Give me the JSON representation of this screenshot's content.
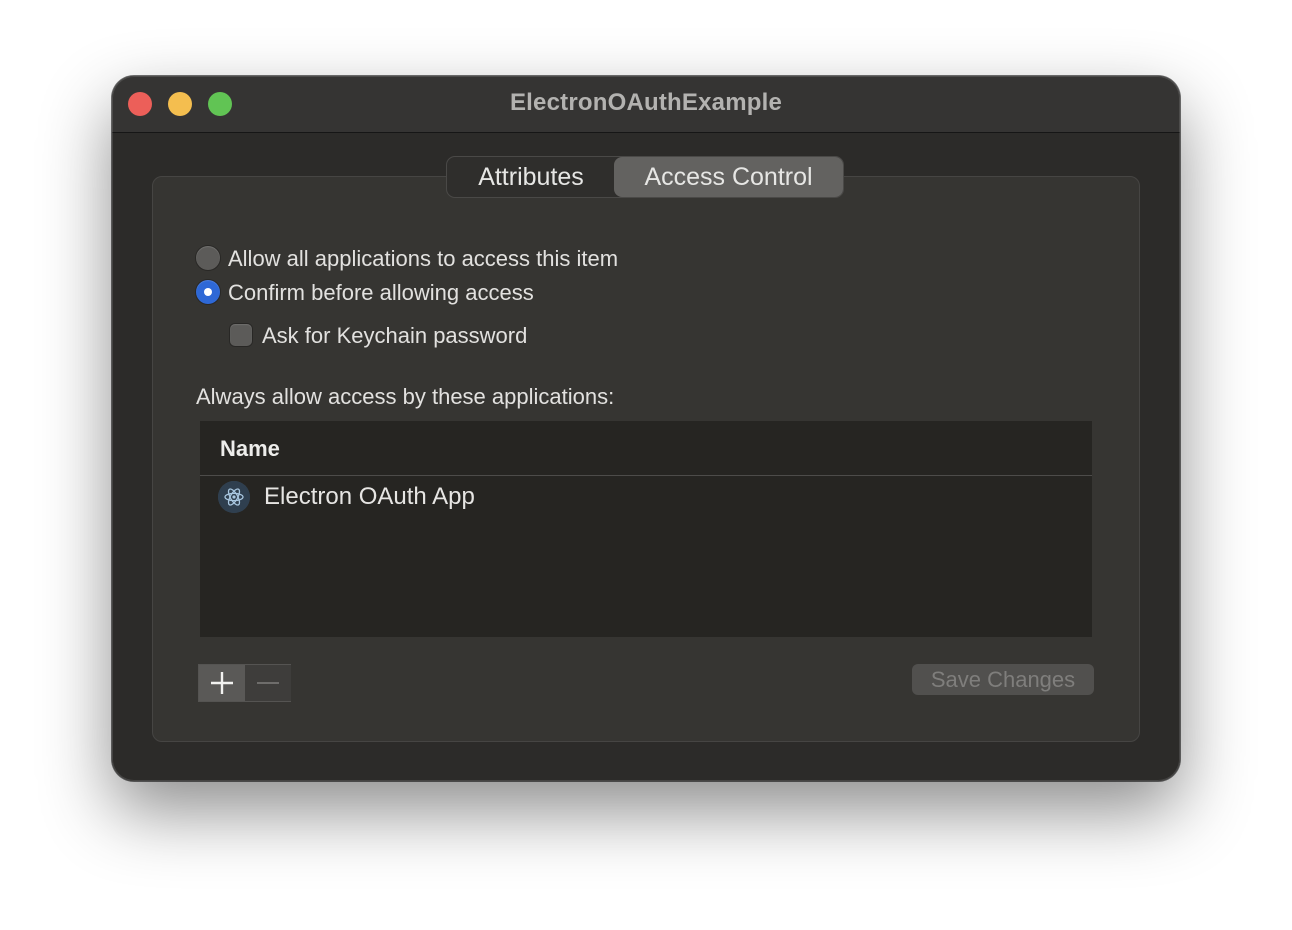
{
  "window": {
    "title": "ElectronOAuthExample"
  },
  "tabs": [
    {
      "label": "Attributes",
      "selected": false
    },
    {
      "label": "Access Control",
      "selected": true
    }
  ],
  "access": {
    "option_allow_all": "Allow all applications to access this item",
    "option_confirm": "Confirm before allowing access",
    "checkbox_keychain": "Ask for Keychain password",
    "selected_option": "confirm",
    "keychain_checked": false
  },
  "apps_section": {
    "label": "Always allow access by these applications:",
    "column_name": "Name",
    "rows": [
      {
        "name": "Electron OAuth App",
        "icon": "electron-app-icon"
      }
    ]
  },
  "buttons": {
    "add_icon": "plus-icon",
    "remove_icon": "minus-icon",
    "save_label": "Save Changes",
    "save_enabled": false
  },
  "colors": {
    "accent": "#2e68d6",
    "close": "#ec5f59",
    "minimize": "#f4be4f",
    "zoom": "#61c454"
  }
}
